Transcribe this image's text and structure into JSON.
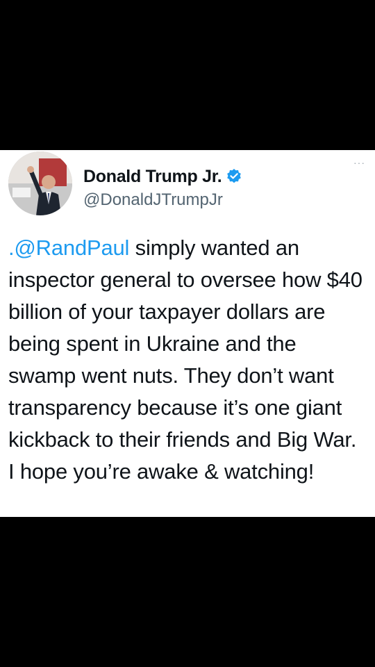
{
  "tweet": {
    "author_name": "Donald Trump Jr.",
    "author_handle": "@DonaldJTrumpJr",
    "more_label": "···",
    "body_mention": ".@RandPaul",
    "body_rest": " simply wanted an inspector general to oversee how $40 billion of your taxpayer dollars are being spent in Ukraine and the swamp went nuts. They don’t want transparency because it’s one giant kickback to their friends and Big War.",
    "body_last_line": "I hope you’re awake & watching!",
    "verified_icon": "verified-badge-icon",
    "colors": {
      "link": "#1d9bf0",
      "text": "#0f1419",
      "secondary": "#536471",
      "background": "#ffffff",
      "letterbox": "#000000"
    }
  }
}
